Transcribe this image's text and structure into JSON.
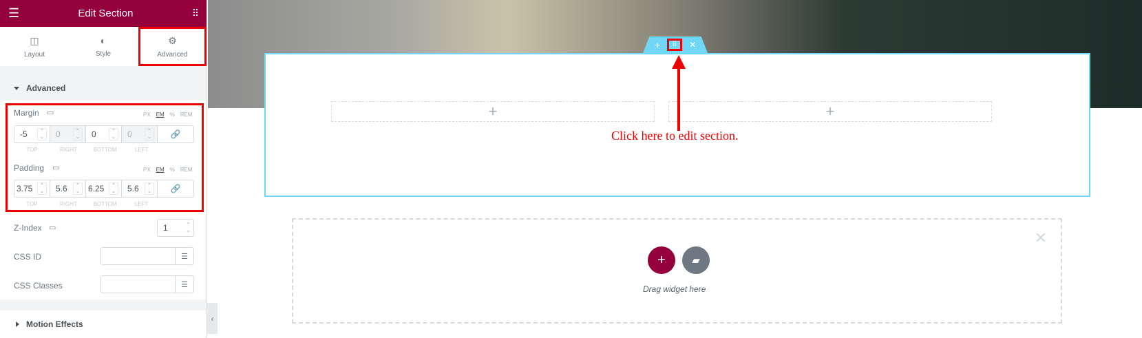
{
  "header": {
    "title": "Edit Section",
    "menu_icon": "hamburger-icon",
    "apps_icon": "grid-icon"
  },
  "tabs": [
    {
      "label": "Layout",
      "icon": "layout-icon"
    },
    {
      "label": "Style",
      "icon": "contrast-icon"
    },
    {
      "label": "Advanced",
      "icon": "gear-icon"
    }
  ],
  "advanced": {
    "heading": "Advanced",
    "units": [
      "PX",
      "EM",
      "%",
      "REM"
    ],
    "margin": {
      "label": "Margin",
      "values": [
        "-5",
        "0",
        "0",
        "0"
      ]
    },
    "padding": {
      "label": "Padding",
      "values": [
        "3.75",
        "5.6",
        "6.25",
        "5.6"
      ]
    },
    "sides": [
      "TOP",
      "RIGHT",
      "BOTTOM",
      "LEFT"
    ],
    "zindex": {
      "label": "Z-Index",
      "value": "1"
    },
    "css_id": {
      "label": "CSS ID",
      "value": ""
    },
    "css_classes": {
      "label": "CSS Classes",
      "value": ""
    }
  },
  "motion": {
    "heading": "Motion Effects"
  },
  "canvas": {
    "annotation": "Click here to edit section.",
    "drag_text": "Drag widget here",
    "accent": "#71d7f7",
    "brand": "#93003c"
  }
}
